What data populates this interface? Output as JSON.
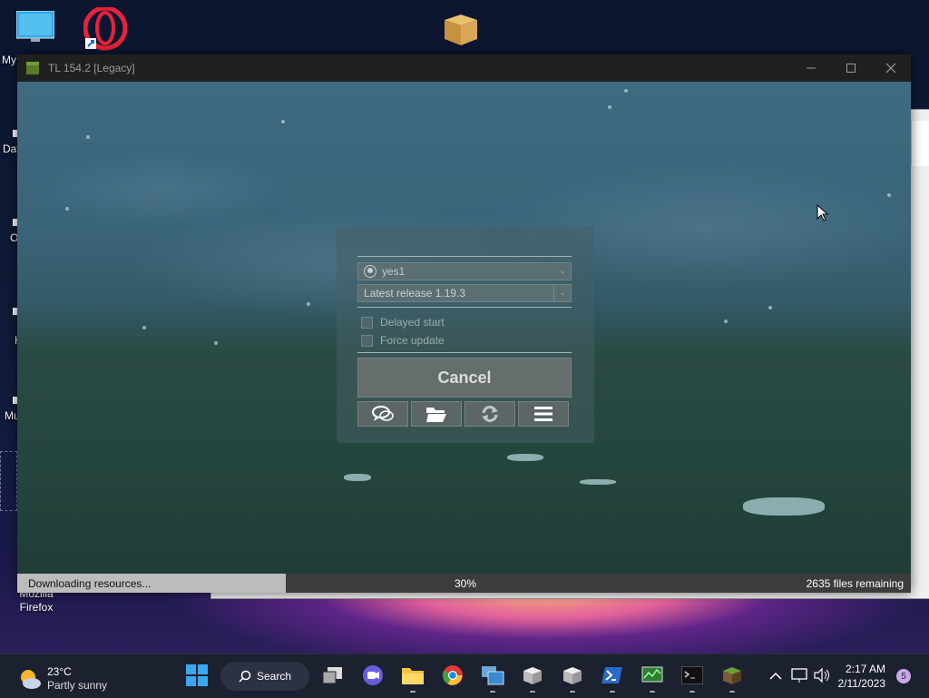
{
  "desktop": {
    "icons": [
      {
        "label": "My"
      },
      {
        "label": "Dat"
      },
      {
        "label": "O"
      },
      {
        "label": "H"
      },
      {
        "label": "Mu"
      },
      {
        "label": "Mozilla Firefox"
      }
    ]
  },
  "window": {
    "title": "TL 154.2 [Legacy]",
    "minimize_icon": "minimize-icon",
    "maximize_icon": "maximize-icon",
    "close_icon": "close-icon"
  },
  "login": {
    "account": "yes1",
    "version": "Latest release 1.19.3",
    "delayed_start_label": "Delayed start",
    "force_update_label": "Force update",
    "cancel_label": "Cancel",
    "tools": [
      "chat-icon",
      "folder-icon",
      "refresh-icon",
      "menu-icon"
    ]
  },
  "progress": {
    "status": "Downloading resources...",
    "percent_label": "30%",
    "value": 0.3,
    "files_remaining": "2635 files remaining"
  },
  "taskbar": {
    "weather_temp": "23°C",
    "weather_desc": "Partly sunny",
    "search_label": "Search",
    "time": "2:17 AM",
    "date": "2/11/2023",
    "notification_count": "5"
  },
  "colors": {
    "progress_fill": "#bcbcbc",
    "titlebar": "#202020",
    "taskbar": "#1c2130"
  }
}
